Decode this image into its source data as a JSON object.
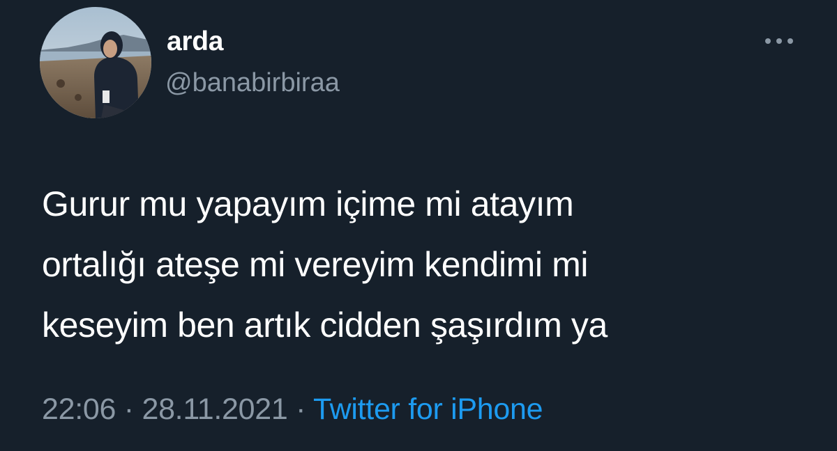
{
  "tweet": {
    "author": {
      "display_name": "arda",
      "handle": "@banabirbiraa",
      "avatar_icon": "avatar-photo"
    },
    "more_icon": "more-options-icon",
    "text": "Gurur mu yapayım içime mi atayım\nortalığı ateşe mi vereyim kendimi mi\nkeseyim ben artık cidden şaşırdım ya",
    "time": "22:06",
    "separator": "·",
    "date": "28.11.2021",
    "source": "Twitter for iPhone"
  },
  "colors": {
    "background": "#16202b",
    "text": "#ffffff",
    "secondary": "#8b98a5",
    "link": "#1d9bf0"
  }
}
